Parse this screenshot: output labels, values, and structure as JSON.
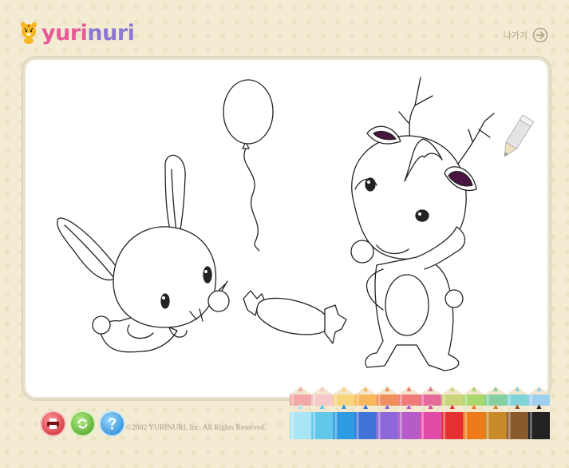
{
  "logo": {
    "part1": "yuri",
    "part2": "nuri"
  },
  "header": {
    "exit_label": "나가기"
  },
  "icons": {
    "mascot": "tiger-cub-icon",
    "exit": "arrow-right-circle-icon",
    "cursor": "pencil-icon",
    "print": "printer-icon",
    "reset": "refresh-icon",
    "help": "question-icon"
  },
  "footer": {
    "copyright": "©2002 YURINURI, Inc. All Rights Reserved."
  },
  "palette": {
    "top_row": [
      "#f4a7a7",
      "#f5c9c9",
      "#f8d47a",
      "#f7b75c",
      "#ef8f5a",
      "#f07a7a",
      "#e56b9b",
      "#c8d57a",
      "#a9d86e",
      "#86cfa0",
      "#7fd3d6",
      "#9fd0f0"
    ],
    "bottom_row": [
      "#a9e6f5",
      "#63c7ea",
      "#2e9ae0",
      "#3f73d8",
      "#8c68d8",
      "#b65cc8",
      "#e24aa8",
      "#e53030",
      "#ef7a1a",
      "#c98a2a",
      "#8a5a2a",
      "#222222"
    ]
  }
}
